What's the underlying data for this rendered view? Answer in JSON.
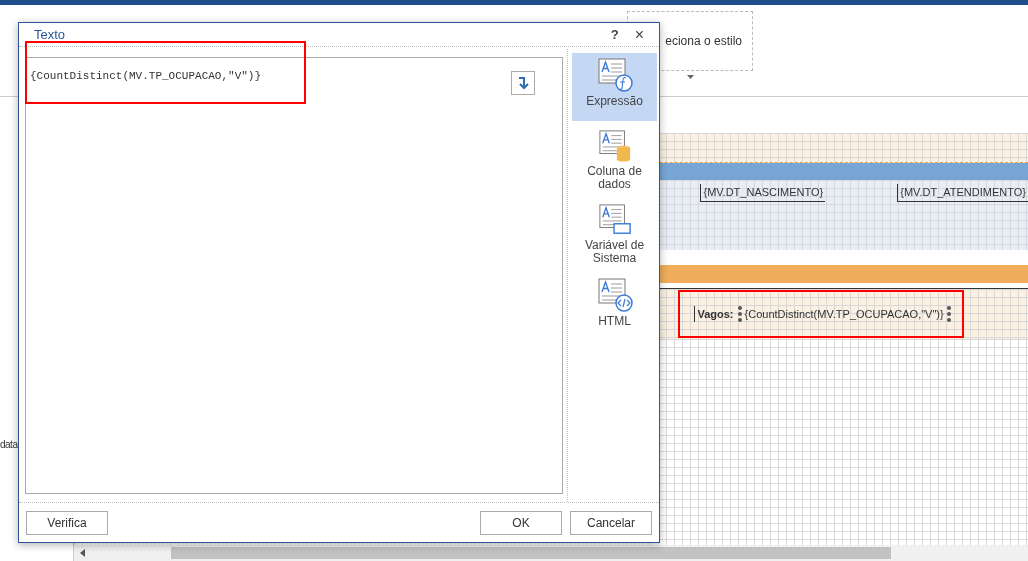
{
  "ribbon": {
    "style_box": {
      "text": "eciona o estilo"
    }
  },
  "left_panel": {
    "label": "data"
  },
  "report": {
    "header_fields": [
      "{MV.DT_NASCIMENTO}",
      "{MV.DT_ATENDIMENTO}"
    ],
    "footer": {
      "label": "Vagos:",
      "expression": "{CountDistinct(MV.TP_OCUPACAO,\"V\")}",
      "selected": true
    }
  },
  "dialog": {
    "title": "Texto",
    "help": "?",
    "close": "×",
    "expression": "{CountDistinct(MV.TP_OCUPACAO,\"V\")}",
    "sidebar": [
      {
        "label": "Expressão",
        "kind": "expression",
        "selected": true
      },
      {
        "label": "Coluna de dados",
        "kind": "column",
        "selected": false
      },
      {
        "label": "Variável de Sistema",
        "kind": "variable",
        "selected": false
      },
      {
        "label": "HTML",
        "kind": "html",
        "selected": false
      }
    ],
    "buttons": {
      "verify": "Verifica",
      "ok": "OK",
      "cancel": "Cancelar"
    }
  }
}
